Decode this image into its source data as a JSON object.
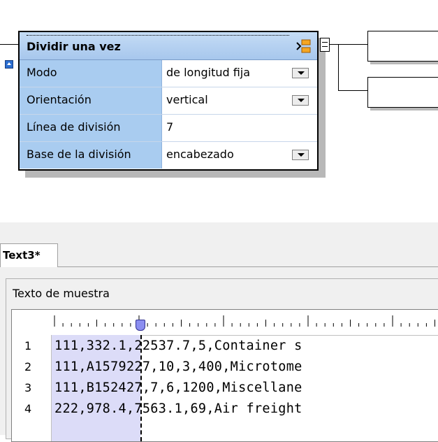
{
  "component": {
    "title": "Dividir una vez",
    "rows": [
      {
        "label": "Modo",
        "value": "de longitud fija",
        "dropdown": true
      },
      {
        "label": "Orientación",
        "value": "vertical",
        "dropdown": true
      },
      {
        "label": "Línea de división",
        "value": "7",
        "dropdown": false
      },
      {
        "label": "Base de la división",
        "value": "encabezado",
        "dropdown": true
      }
    ]
  },
  "tab": {
    "label": "Text3*"
  },
  "sample_panel": {
    "title": "Texto de muestra",
    "lines": [
      {
        "num": "1",
        "text": "111,332.1,22537.7,5,Container s"
      },
      {
        "num": "2",
        "text": "111,A1579227,10,3,400,Microtome"
      },
      {
        "num": "3",
        "text": "111,B152427,7,6,1200,Miscellane"
      },
      {
        "num": "4",
        "text": "222,978.4,7563.1,69,Air freight"
      }
    ]
  },
  "colors": {
    "header": "#a7c7ed",
    "label_bg": "#a9ccf0",
    "split_highlight": "#dcdcf8",
    "marker": "#8b8ef0"
  }
}
